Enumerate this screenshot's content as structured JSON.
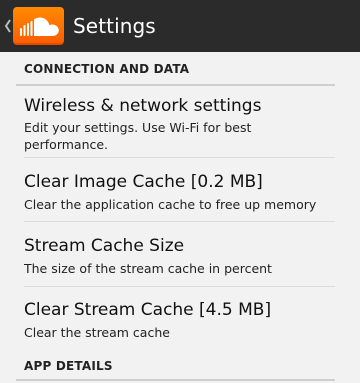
{
  "action_bar": {
    "title": "Settings",
    "icon": "soundcloud-icon",
    "back_icon": "chevron-left-icon"
  },
  "sections": {
    "connection": {
      "header": "CONNECTION AND DATA",
      "items": [
        {
          "title": "Wireless & network settings",
          "summary": "Edit your settings. Use Wi-Fi for best performance."
        },
        {
          "title": "Clear Image Cache [0.2 MB]",
          "summary": "Clear the application cache to free up memory"
        },
        {
          "title": "Stream Cache Size",
          "summary": "The size of the stream cache in percent"
        },
        {
          "title": "Clear Stream Cache [4.5 MB]",
          "summary": "Clear the stream cache"
        }
      ]
    },
    "app_details": {
      "header": "APP DETAILS"
    }
  },
  "colors": {
    "action_bar": "#2b2b2b",
    "brand": "#ff6a00",
    "background": "#f2f2f2",
    "divider": "#dcdcdc"
  }
}
